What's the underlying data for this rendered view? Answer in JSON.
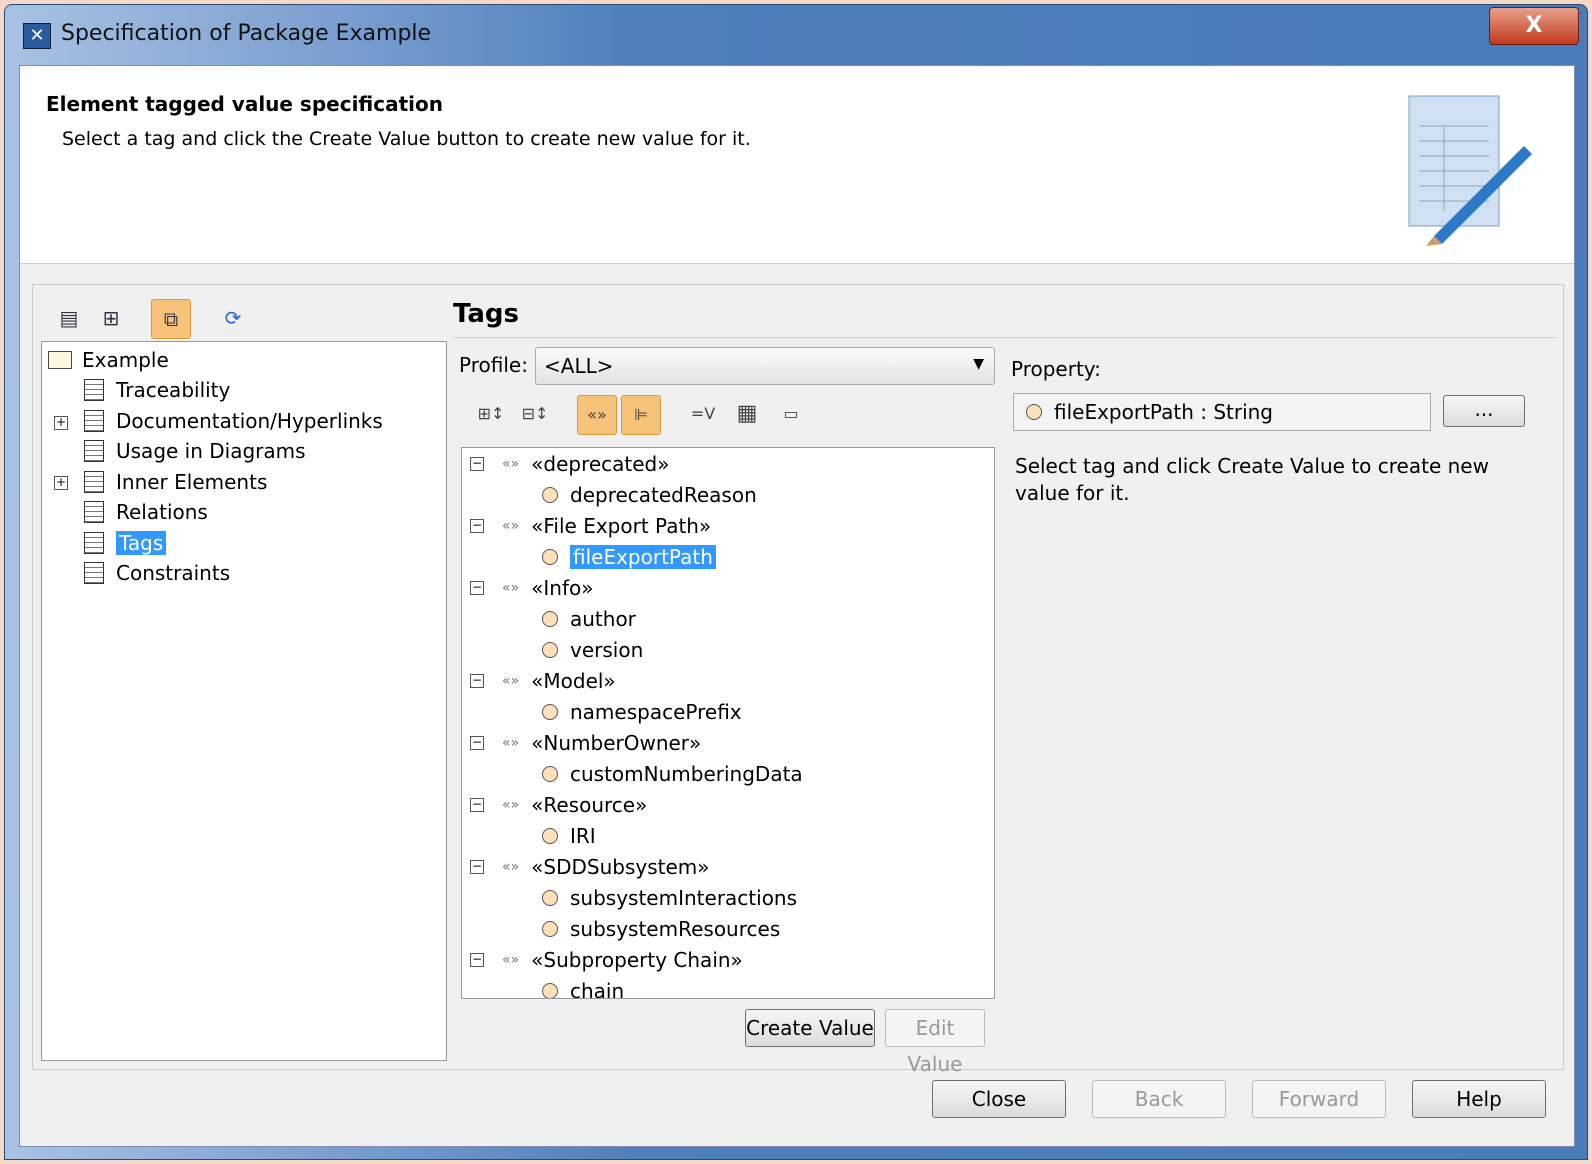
{
  "window": {
    "title": "Specification of Package Example",
    "close": "X"
  },
  "header": {
    "title": "Element tagged value specification",
    "description": "Select a tag and click the Create Value button to create new value for it."
  },
  "nav": {
    "items": [
      {
        "label": "Example"
      },
      {
        "label": "Traceability"
      },
      {
        "label": "Documentation/Hyperlinks"
      },
      {
        "label": "Usage in Diagrams"
      },
      {
        "label": "Inner Elements"
      },
      {
        "label": "Relations"
      },
      {
        "label": "Tags"
      },
      {
        "label": "Constraints"
      }
    ]
  },
  "tags": {
    "heading": "Tags",
    "profile_label": "Profile:",
    "profile_value": "<ALL>",
    "property_label": "Property:",
    "property_value": "fileExportPath : String",
    "property_button": "...",
    "hint": "Select tag and click Create Value to create new value for it.",
    "tree": [
      {
        "stereotype": "«deprecated»",
        "props": [
          "deprecatedReason"
        ]
      },
      {
        "stereotype": "«File Export Path»",
        "props": [
          "fileExportPath"
        ]
      },
      {
        "stereotype": "«Info»",
        "props": [
          "author",
          "version"
        ]
      },
      {
        "stereotype": "«Model»",
        "props": [
          "namespacePrefix"
        ]
      },
      {
        "stereotype": "«NumberOwner»",
        "props": [
          "customNumberingData"
        ]
      },
      {
        "stereotype": "«Resource»",
        "props": [
          "IRI"
        ]
      },
      {
        "stereotype": "«SDDSubsystem»",
        "props": [
          "subsystemInteractions",
          "subsystemResources"
        ]
      },
      {
        "stereotype": "«Subproperty Chain»",
        "props": [
          "chain"
        ]
      }
    ],
    "create_value": "Create Value",
    "edit_value": "Edit Value",
    "equals_v": "=V"
  },
  "footer": {
    "close": "Close",
    "back": "Back",
    "forward": "Forward",
    "help": "Help"
  }
}
